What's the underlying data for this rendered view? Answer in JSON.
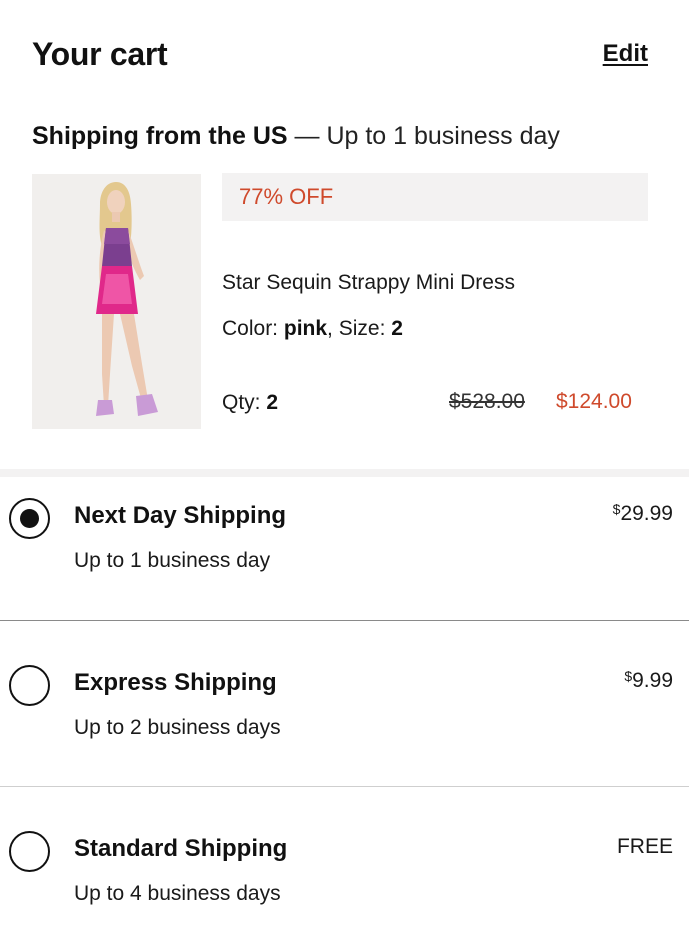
{
  "header": {
    "title": "Your cart",
    "edit_label": "Edit"
  },
  "shipping_from": {
    "origin": "Shipping from the US",
    "separator": "—",
    "eta": "Up to 1 business day"
  },
  "product": {
    "image_alt": "Model wearing pink sequin mini dress",
    "discount_badge": "77% OFF",
    "name": "Star Sequin Strappy Mini Dress",
    "color_label": "Color:",
    "color_value": "pink",
    "size_label": "Size:",
    "size_value": "2",
    "qty_label": "Qty:",
    "qty_value": "2",
    "original_price": "$528.00",
    "sale_price": "$124.00"
  },
  "shipping_options": [
    {
      "name": "Next Day Shipping",
      "eta": "Up to 1 business day",
      "price_currency": "$",
      "price_amount": "29.99",
      "selected": true
    },
    {
      "name": "Express Shipping",
      "eta": "Up to 2 business days",
      "price_currency": "$",
      "price_amount": "9.99",
      "selected": false
    },
    {
      "name": "Standard Shipping",
      "eta": "Up to 4 business days",
      "price_currency": "",
      "price_amount": "FREE",
      "selected": false
    }
  ],
  "colors": {
    "accent_red": "#cf4a2c",
    "badge_bg": "#f3f2f2",
    "text": "#111111",
    "dress_pink": "#e0288a"
  }
}
